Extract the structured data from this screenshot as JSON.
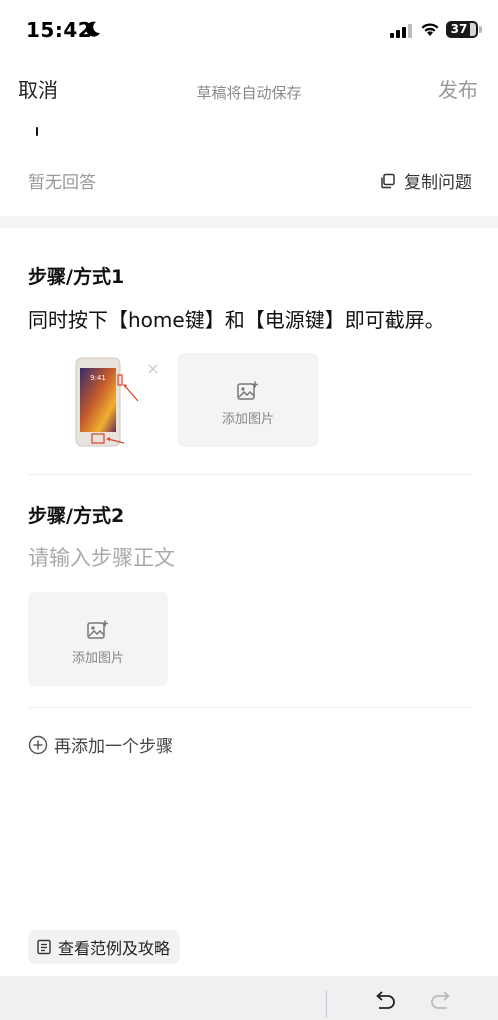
{
  "status_bar": {
    "time": "15:42",
    "battery": "37",
    "icons": [
      "moon-icon",
      "signal-icon",
      "wifi-icon",
      "battery-icon"
    ]
  },
  "nav": {
    "cancel": "取消",
    "draft_status": "草稿将自动保存",
    "publish": "发布"
  },
  "question": {
    "answer_status": "暂无回答",
    "copy_label": "复制问题"
  },
  "steps": [
    {
      "title": "步骤/方式1",
      "body": "同时按下【home键】和【电源键】即可截屏。",
      "add_image_label": "添加图片"
    },
    {
      "title": "步骤/方式2",
      "placeholder": "请输入步骤正文",
      "add_image_label": "添加图片"
    }
  ],
  "add_step_label": "再添加一个步骤",
  "guide_label": "查看范例及攻略",
  "colors": {
    "accent_red": "#d9442e",
    "muted_gray": "#999999",
    "panel_gray": "#f4f4f6"
  }
}
